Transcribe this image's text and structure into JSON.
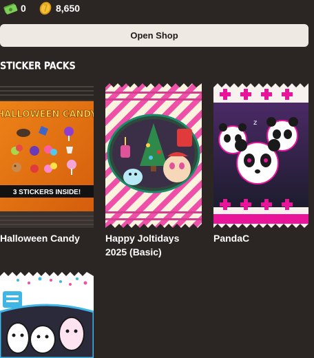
{
  "currencies": {
    "cash": {
      "icon": "cash-icon",
      "value": "0",
      "color": "#6fbf4a"
    },
    "coins": {
      "icon": "coin-icon",
      "value": "8,650",
      "color": "#f0b429"
    }
  },
  "shop_button": {
    "label": "Open Shop"
  },
  "section": {
    "title": "STICKER PACKS"
  },
  "packs": [
    {
      "name": "Halloween Candy",
      "pack_title": "HALLOWEEN CANDY",
      "pack_footer": "3 STICKERS INSIDE!",
      "accent": "#f07a12"
    },
    {
      "name": "Happy Joltidays 2025 (Basic)",
      "name_line1": "Happy Joltidays",
      "name_line2": "2025 (Basic)",
      "accent": "#ee4fa8"
    },
    {
      "name": "PandaC",
      "accent": "#e8149a"
    },
    {
      "name": "",
      "accent": "#3fb6e6"
    }
  ]
}
